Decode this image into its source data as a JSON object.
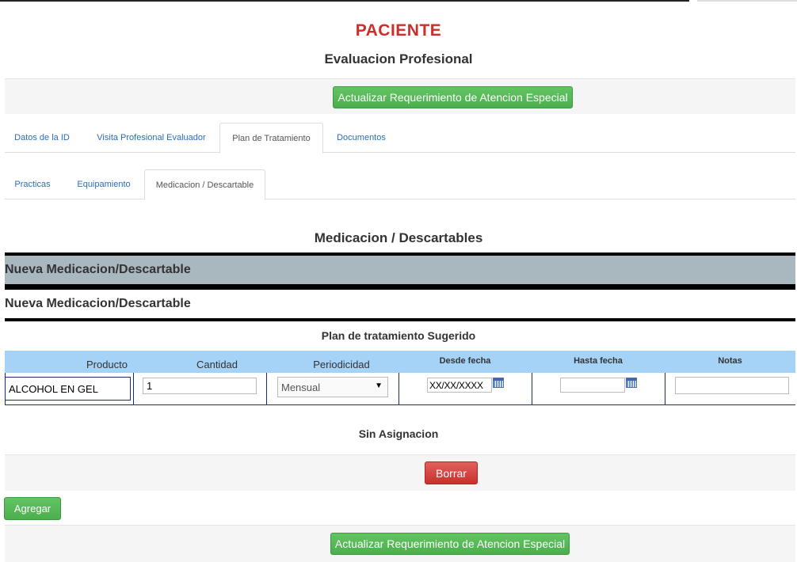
{
  "page": {
    "title": "PACIENTE",
    "subtitle": "Evaluacion Profesional"
  },
  "actions": {
    "update_button": "Actualizar Requerimiento de Atencion Especial"
  },
  "main_tabs": [
    {
      "label": "Datos de la ID",
      "active": false
    },
    {
      "label": "Visita Profesional Evaluador",
      "active": false
    },
    {
      "label": "Plan de Tratamiento",
      "active": true
    },
    {
      "label": "Documentos",
      "active": false
    }
  ],
  "sub_tabs": [
    {
      "label": "Practicas",
      "active": false
    },
    {
      "label": "Equipamiento",
      "active": false
    },
    {
      "label": "Medicacion / Descartable",
      "active": true
    }
  ],
  "section": {
    "title": "Medicacion / Descartables",
    "band_heading": "Nueva Medicacion/Descartable",
    "sub_heading": "Nueva Medicacion/Descartable",
    "plan_title": "Plan de tratamiento Sugerido"
  },
  "table": {
    "headers": [
      "Producto",
      "Cantidad",
      "Periodicidad",
      "Desde fecha",
      "Hasta fecha",
      "Notas"
    ],
    "row": {
      "producto": "ALCOHOL EN GEL",
      "cantidad": "1",
      "periodicidad": "Mensual",
      "desde_fecha": "XX/XX/XXXX",
      "hasta_fecha": "",
      "notas": ""
    }
  },
  "assignment_status": "Sin Asignacion",
  "buttons": {
    "delete": "Borrar",
    "add": "Agregar"
  },
  "icons": {
    "calendar": "calendar-icon",
    "dropdown": "chevron-down-icon"
  },
  "colors": {
    "title_red": "#c9302c",
    "button_green": "#4cae4c",
    "button_red": "#c9302c",
    "table_header_blue": "#a5d2f7",
    "band_grey": "#a9b7bf",
    "link_blue": "#2a6ebb"
  }
}
